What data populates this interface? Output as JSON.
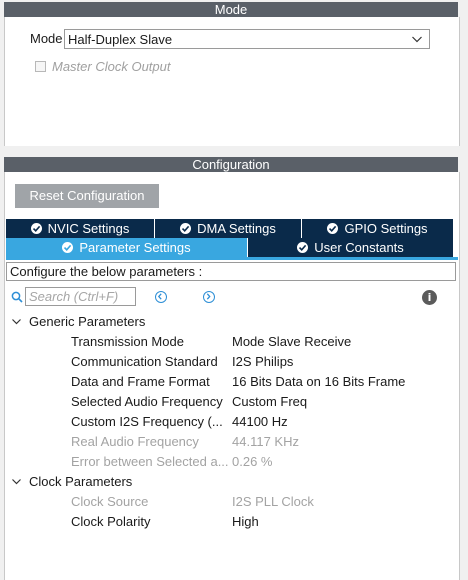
{
  "mode_section": {
    "header": "Mode",
    "mode_label": "Mode",
    "mode_value": "Half-Duplex Slave",
    "master_clock_label": "Master Clock Output",
    "master_clock_checked": false
  },
  "config_section": {
    "header": "Configuration",
    "reset_button": "Reset Configuration",
    "tabs_row1": [
      {
        "label": "NVIC Settings",
        "active": false
      },
      {
        "label": "DMA Settings",
        "active": false
      },
      {
        "label": "GPIO Settings",
        "active": false
      }
    ],
    "tabs_row2": [
      {
        "label": "Parameter Settings",
        "active": true
      },
      {
        "label": "User Constants",
        "active": false
      }
    ],
    "configure_text": "Configure the below parameters :",
    "search_placeholder": "Search (Ctrl+F)",
    "info_glyph": "i"
  },
  "groups": [
    {
      "name": "Generic Parameters",
      "params": [
        {
          "name": "Transmission Mode",
          "value": "Mode Slave Receive",
          "enabled": true
        },
        {
          "name": "Communication Standard",
          "value": "I2S Philips",
          "enabled": true
        },
        {
          "name": "Data and Frame Format",
          "value": "16 Bits Data on 16 Bits Frame",
          "enabled": true
        },
        {
          "name": "Selected Audio Frequency",
          "value": "Custom Freq",
          "enabled": true
        },
        {
          "name": "Custom I2S Frequency (...",
          "value": "44100 Hz",
          "enabled": true
        },
        {
          "name": "Real Audio Frequency",
          "value": "44.117 KHz",
          "enabled": false
        },
        {
          "name": "Error between Selected a...",
          "value": "0.26 %",
          "enabled": false
        }
      ]
    },
    {
      "name": "Clock Parameters",
      "params": [
        {
          "name": "Clock Source",
          "value": "I2S PLL Clock",
          "enabled": false
        },
        {
          "name": "Clock Polarity",
          "value": "High",
          "enabled": true
        }
      ]
    }
  ]
}
